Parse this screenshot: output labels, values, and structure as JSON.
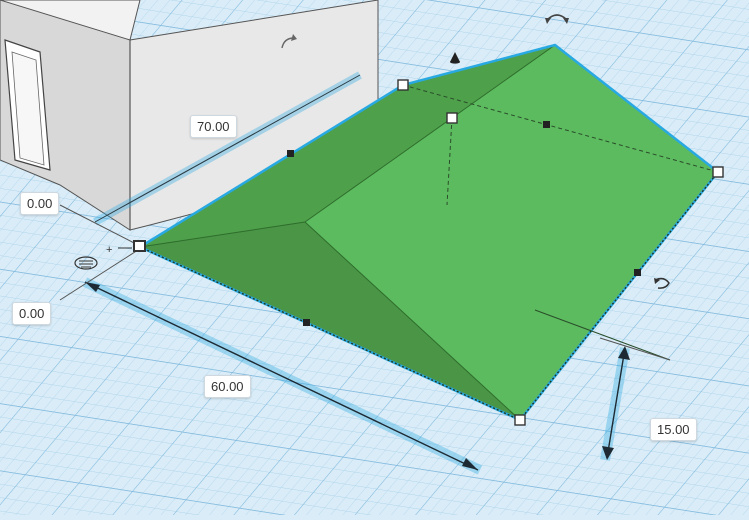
{
  "dimensions": {
    "length": "70.00",
    "offset_y": "0.00",
    "offset_x": "0.00",
    "width": "60.00",
    "height": "15.00"
  },
  "colors": {
    "grid_bg": "#d9ecf7",
    "grid_line": "#9fcbe6",
    "roof_top": "#5cb85c",
    "roof_front": "#4e9f4e",
    "roof_side": "#46903f",
    "selection": "#29a9e1",
    "wall": "#e6e6e6"
  },
  "icons": {
    "rotate_top": "rotate-arrow-icon",
    "rotate_side": "rotate-arrow-icon",
    "rotate_wall": "rotate-arrow-icon",
    "lift": "lift-cone-icon",
    "origin": "snap-origin-icon"
  }
}
